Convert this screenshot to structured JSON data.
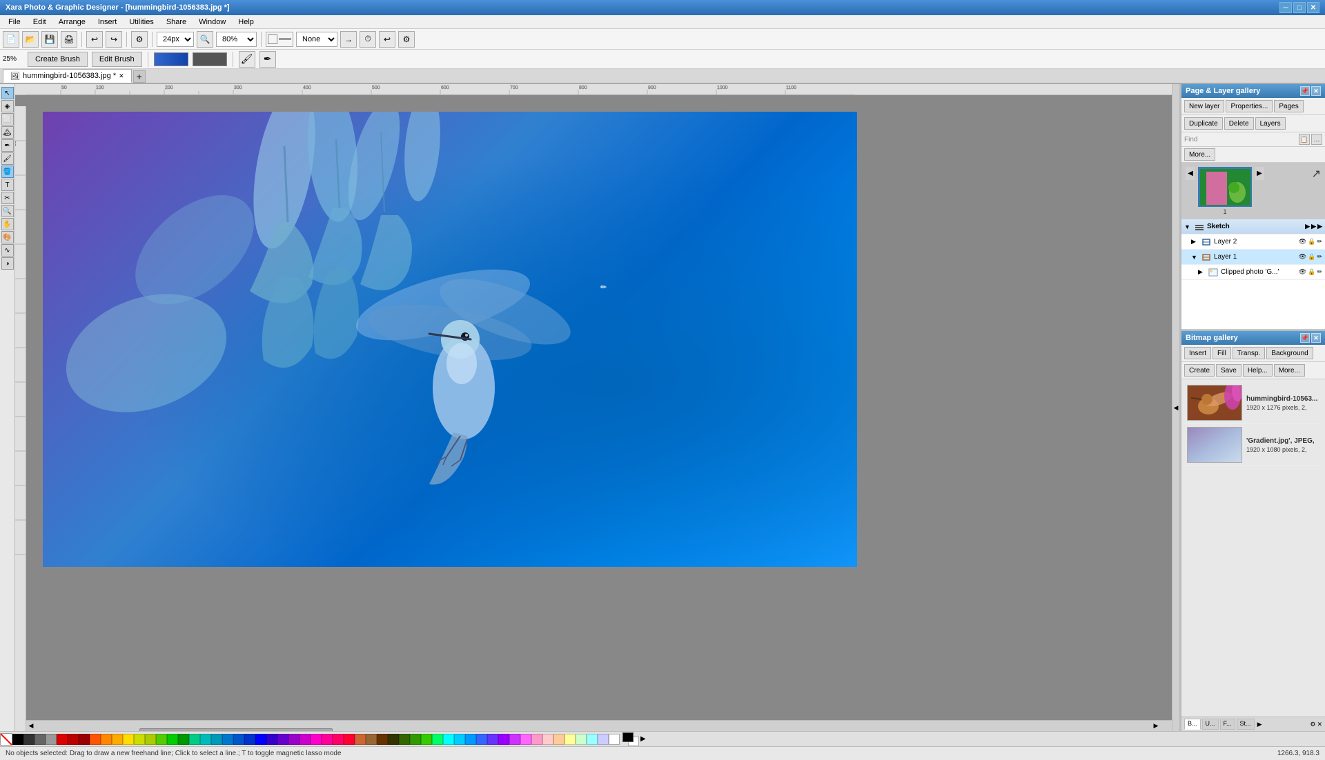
{
  "app": {
    "title": "Xara Photo & Graphic Designer - [hummingbird-1056383.jpg *]"
  },
  "titlebar": {
    "title": "Xara Photo & Graphic Designer - [hummingbird-1056383.jpg *]",
    "controls": [
      "─",
      "□",
      "✕"
    ]
  },
  "menubar": {
    "items": [
      "File",
      "Edit",
      "Arrange",
      "Insert",
      "Utilities",
      "Share",
      "Window",
      "Help"
    ]
  },
  "toolbar1": {
    "zoom_value": "24px",
    "zoom_percent": "80%",
    "fit_label": "None",
    "buttons": [
      "new",
      "open",
      "save",
      "print",
      "",
      "undo",
      "redo",
      "",
      "zoom",
      "",
      "",
      "",
      ""
    ]
  },
  "toolbar2": {
    "percent_label": "25%",
    "create_brush_label": "Create Brush",
    "edit_brush_label": "Edit Brush"
  },
  "tabs": {
    "items": [
      {
        "label": "hummingbird-1056383.jpg",
        "active": true
      }
    ],
    "new_tab_label": "+"
  },
  "canvas": {
    "zoom": "80%"
  },
  "page_layer_gallery": {
    "title": "Page & Layer gallery",
    "buttons": {
      "new_layer": "New layer",
      "properties": "Properties...",
      "pages_tab": "Pages",
      "duplicate": "Duplicate",
      "delete": "Delete",
      "layers_tab": "Layers",
      "find_label": "Find",
      "more_label": "More..."
    },
    "page_thumbnail": {
      "number": "1"
    },
    "layers": [
      {
        "name": "Sketch",
        "level": 0,
        "expanded": true,
        "type": "group",
        "color": "#aa3333"
      },
      {
        "name": "Layer 2",
        "level": 1,
        "expanded": false,
        "type": "layer",
        "color": "#3388aa"
      },
      {
        "name": "Layer 1",
        "level": 1,
        "expanded": true,
        "type": "layer",
        "color": "#aa6633"
      },
      {
        "name": "Clipped photo 'G...'",
        "level": 2,
        "expanded": false,
        "type": "image",
        "color": "#6688aa"
      }
    ]
  },
  "bitmap_gallery": {
    "title": "Bitmap gallery",
    "buttons": {
      "insert": "Insert",
      "fill": "Fill",
      "transp": "Transp.",
      "background": "Background",
      "create": "Create",
      "save": "Save",
      "help": "Help...",
      "more": "More..."
    },
    "items": [
      {
        "name": "hummingbird-10563...",
        "info": "1920 x 1276 pixels, 2,",
        "thumb_type": "hummingbird"
      },
      {
        "name": "'Gradient.jpg',  JPEG,",
        "info": "1920 x 1080 pixels, 2,",
        "thumb_type": "gradient"
      }
    ]
  },
  "statusbar": {
    "message": "No objects selected: Drag to draw a new freehand line; Click to select a line.; T to toggle magnetic lasso mode",
    "coords": "1266.3, 918.3"
  },
  "palette": {
    "colors": [
      "#000000",
      "#ffffff",
      "#cccccc",
      "#888888",
      "#ff0000",
      "#cc0000",
      "#aa0000",
      "#ff6600",
      "#ff9900",
      "#ffcc00",
      "#ffff00",
      "#ccff00",
      "#00ff00",
      "#00cc00",
      "#009900",
      "#00ffcc",
      "#00cccc",
      "#0099cc",
      "#0066cc",
      "#0033cc",
      "#0000ff",
      "#3300cc",
      "#6600cc",
      "#9900cc",
      "#cc00cc",
      "#ff00cc",
      "#ff0099",
      "#ff0066",
      "#ff0033",
      "#cc6633",
      "#996633",
      "#663300",
      "#333300",
      "#336600",
      "#339900",
      "#33cc00",
      "#00ff66",
      "#00ffff",
      "#00ccff",
      "#0099ff",
      "#3366ff",
      "#6633ff",
      "#9900ff",
      "#cc33ff",
      "#ff66ff",
      "#ff99cc",
      "#ffcccc",
      "#ffcc99",
      "#ffff99",
      "#ccffcc",
      "#99ffff",
      "#ccccff",
      "#ffffff"
    ]
  }
}
